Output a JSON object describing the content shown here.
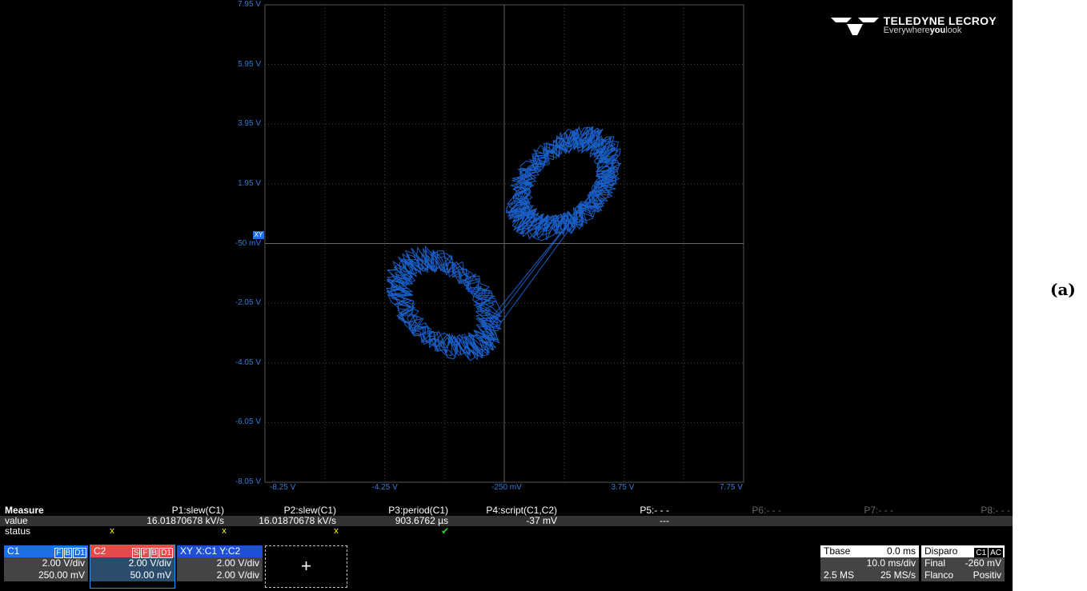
{
  "logo": {
    "brand": "TELEDYNE LECROY",
    "tag_pre": "Everywhere",
    "tag_bold": "you",
    "tag_post": "look"
  },
  "xy_marker": "XY",
  "axes": {
    "y_labels": [
      "7.95 V",
      "5.95 V",
      "3.95 V",
      "1.95 V",
      "-50 mV",
      "-2.05 V",
      "-4.05 V",
      "-6.05 V",
      "-8.05 V"
    ],
    "x_labels": [
      "-8.25 V",
      "-4.25 V",
      "-250 mV",
      "3.75 V",
      "7.75 V"
    ]
  },
  "colors": {
    "trace": "#1d6fe8",
    "c1": "#1d6fe8",
    "c2": "#e34a4a",
    "xy": "#1d4fd8"
  },
  "measure": {
    "title": "Measure",
    "row_value": "value",
    "row_status": "status",
    "params": [
      {
        "name": "P1:slew(C1)",
        "value": "16.01870678 kV/s",
        "status": "x"
      },
      {
        "name": "P2:slew(C1)",
        "value": "16.01870678 kV/s",
        "status": "x"
      },
      {
        "name": "P3:period(C1)",
        "value": "903.6762 µs",
        "status": "x"
      },
      {
        "name": "P4:script(C1,C2)",
        "value": "-37 mV",
        "status": "✔"
      },
      {
        "name": "P5:- - -",
        "value": "---",
        "status": ""
      },
      {
        "name": "P6:- - -",
        "value": "",
        "status": ""
      },
      {
        "name": "P7:- - -",
        "value": "",
        "status": ""
      },
      {
        "name": "P8:- - -",
        "value": "",
        "status": ""
      }
    ]
  },
  "channels": {
    "c1": {
      "name": "C1",
      "tags": [
        "F",
        "B",
        "D1"
      ],
      "scale": "2.00 V/div",
      "offset": "250.00 mV"
    },
    "c2": {
      "name": "C2",
      "tags": [
        "S",
        "F",
        "B",
        "D1"
      ],
      "scale": "2.00 V/div",
      "offset": "50.00 mV"
    },
    "xy": {
      "name": "XY",
      "source": "X:C1 Y:C2",
      "scale1": "2.00 V/div",
      "scale2": "2.00 V/div"
    },
    "add": "+"
  },
  "timebase": {
    "label": "Tbase",
    "delay": "0.0 ms",
    "scale": "10.0 ms/div",
    "samples": "2.5 MS",
    "rate": "25 MS/s"
  },
  "trigger": {
    "label": "Disparo",
    "channel": "C1",
    "coupling": "AC",
    "mode": "Final",
    "level": "-260 mV",
    "type": "Flanco",
    "slope": "Positiv"
  },
  "figure_label": "(a)"
}
